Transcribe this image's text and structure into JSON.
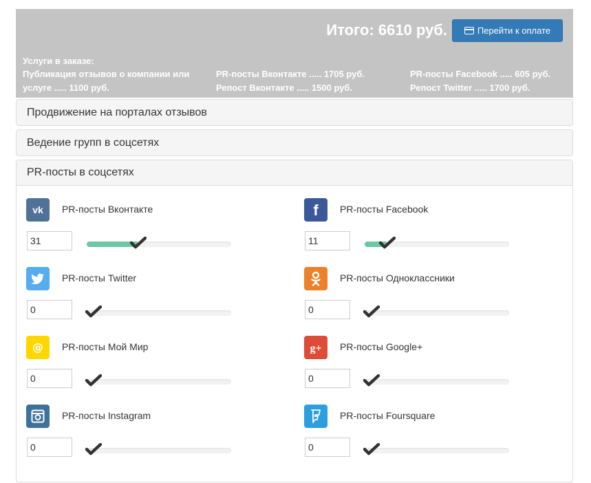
{
  "summary": {
    "total": "Итого: 6610 руб.",
    "pay_button": "Перейти к оплате",
    "services_title": "Услуги в заказе:",
    "services_col1": [
      "Публикация отзывов о компании или услуге ..... 1100 руб."
    ],
    "services_col2": [
      "PR-посты Вконтакте ..... 1705 руб.",
      "Репост Вконтакте ..... 1500 руб."
    ],
    "services_col3": [
      "PR-посты Facebook ..... 605 руб.",
      "Репост Twitter ..... 1700 руб."
    ]
  },
  "panels": {
    "p1": "Продвижение на порталах отзывов",
    "p2": "Ведение групп в соцсетях",
    "p3": "PR-посты в соцсетях"
  },
  "slider_max": 100,
  "items": [
    {
      "label": "PR-посты Вконтакте",
      "value": "31",
      "icon": "vk-icon",
      "color": "#507299",
      "glyph": "vk"
    },
    {
      "label": "PR-посты Facebook",
      "value": "11",
      "icon": "facebook-icon",
      "color": "#3b5998",
      "glyph": "f"
    },
    {
      "label": "PR-посты Twitter",
      "value": "0",
      "icon": "twitter-icon",
      "color": "#55acee",
      "glyph": "bird"
    },
    {
      "label": "PR-посты Одноклассники",
      "value": "0",
      "icon": "odnoklassniki-icon",
      "color": "#ed812b",
      "glyph": "ok"
    },
    {
      "label": "PR-посты Мой Мир",
      "value": "0",
      "icon": "moimir-icon",
      "color": "#ffd700",
      "glyph": "@"
    },
    {
      "label": "PR-посты Google+",
      "value": "0",
      "icon": "googleplus-icon",
      "color": "#dd4b39",
      "glyph": "g+"
    },
    {
      "label": "PR-посты Instagram",
      "value": "0",
      "icon": "instagram-icon",
      "color": "#3f729b",
      "glyph": "cam"
    },
    {
      "label": "PR-посты Foursquare",
      "value": "0",
      "icon": "foursquare-icon",
      "color": "#2d9ee0",
      "glyph": "fs"
    }
  ]
}
